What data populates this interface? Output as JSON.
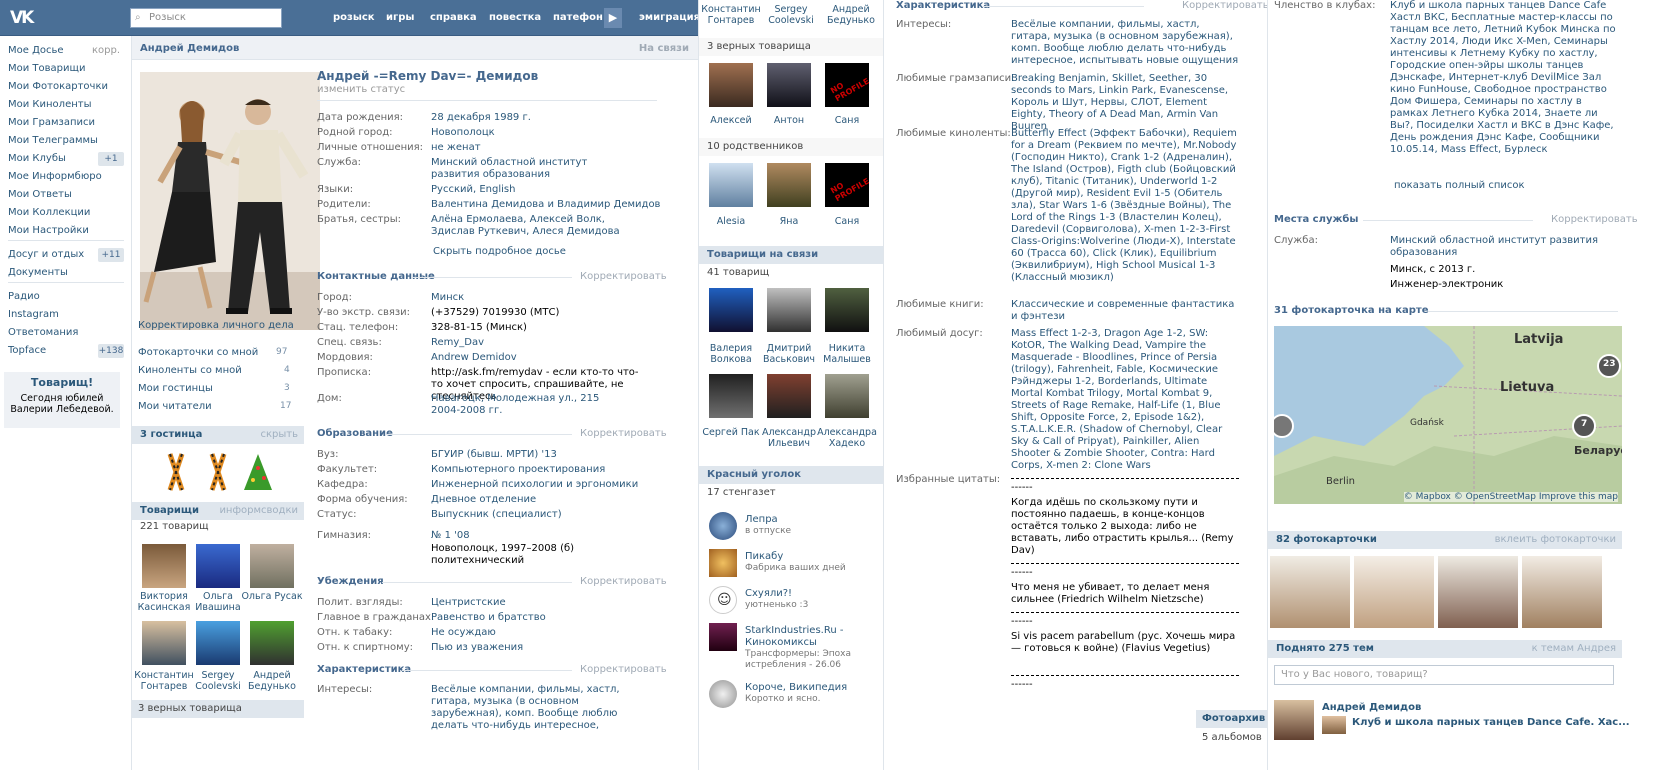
{
  "topbar": {
    "search_placeholder": "Розыск",
    "nav": [
      "розыск",
      "игры",
      "справка",
      "повестка",
      "патефон",
      "эмиграция"
    ]
  },
  "leftmenu": {
    "items": [
      {
        "label": "Мое Досье",
        "extra": "корр."
      },
      {
        "label": "Мои Товарищи"
      },
      {
        "label": "Мои Фотокарточки"
      },
      {
        "label": "Мои Киноленты"
      },
      {
        "label": "Мои Грамзаписи"
      },
      {
        "label": "Мои Телеграммы"
      },
      {
        "label": "Мои Клубы",
        "count": "+1"
      },
      {
        "label": "Мое Информбюро"
      },
      {
        "label": "Мои Ответы"
      },
      {
        "label": "Мои Коллекции"
      },
      {
        "label": "Мои Настройки"
      },
      {
        "label": "Досуг и отдых",
        "count": "+11"
      },
      {
        "label": "Документы"
      },
      {
        "label": "Радио"
      },
      {
        "label": "Instagram"
      },
      {
        "label": "Ответомания"
      },
      {
        "label": "Topface",
        "count": "+138"
      }
    ],
    "birthday": {
      "title": "Товарищ!",
      "text1": "Сегодня юбилей",
      "text2": "Валерии Лебедевой."
    }
  },
  "profile": {
    "header_name": "Андрей Демидов",
    "header_status": "На связи",
    "full_name": "Андрей -=Remy Dav=- Демидов",
    "change_status": "изменить статус",
    "edit_dossier": "Корректировка личного дела",
    "links": [
      {
        "label": "Фотокарточки со мной",
        "count": "97"
      },
      {
        "label": "Киноленты со мной",
        "count": "4"
      },
      {
        "label": "Мои гостинцы",
        "count": "3"
      },
      {
        "label": "Мои читатели",
        "count": "17"
      }
    ],
    "gifts_title": "3 гостинца",
    "gifts_hide": "скрыть",
    "friends_title": "Товарищи",
    "friends_link": "информсводки",
    "friends_count": "221 товарищ",
    "friends": [
      "Виктория Касинская",
      "Ольга Ивашина",
      "Ольга Русак",
      "Константин Гонтарев",
      "Sergey Coolevski",
      "Андрей Бедунько"
    ],
    "loyal_bottom": "3 верных товарища",
    "basic": [
      {
        "k": "Дата рождения:",
        "v": "28 декабря 1989 г."
      },
      {
        "k": "Родной город:",
        "v": "Новополоцк"
      },
      {
        "k": "Личные отношения:",
        "v": "не женат"
      },
      {
        "k": "Служба:",
        "v": "Минский областной институт развития образования"
      },
      {
        "k": "Языки:",
        "v": "Русский, English"
      },
      {
        "k": "Родители:",
        "v": "Валентина Демидова и Владимир Демидов"
      },
      {
        "k": "Братья, сестры:",
        "v": "Алёна Ермолаева, Алексей Волк, Здислав Руткевич, Алеся Демидова"
      }
    ],
    "hide_dossier": "Скрыть подробное досье",
    "contacts_title": "Контактные данные",
    "edit": "Корректировать",
    "contacts": [
      {
        "k": "Город:",
        "v": "Минск"
      },
      {
        "k": "У-во экстр. связи:",
        "v": "(+37529) 7019930 (МТС)"
      },
      {
        "k": "Стац. телефон:",
        "v": "328-81-15 (Минск)"
      },
      {
        "k": "Спец. связь:",
        "v": "Remy_Dav"
      },
      {
        "k": "Мордовия:",
        "v": "Andrew Demidov"
      },
      {
        "k": "Прописка:",
        "v": "http://ask.fm/remydav - если кто-то что-то хочет спросить, спрашивайте, не стесняйтесь"
      },
      {
        "k": "Дом:",
        "v": "Навагоцк, Молодежная ул., 215 2004-2008 гг."
      }
    ],
    "edu_title": "Образование",
    "edu": [
      {
        "k": "Вуз:",
        "v": "БГУИР (бывш. МРТИ) '13"
      },
      {
        "k": "Факультет:",
        "v": "Компьютерного проектирования"
      },
      {
        "k": "Кафедра:",
        "v": "Инженерной психологии и эргономики"
      },
      {
        "k": "Форма обучения:",
        "v": "Дневное отделение"
      },
      {
        "k": "Статус:",
        "v": "Выпускник (специалист)"
      },
      {
        "k": "Гимназия:",
        "v": "№ 1 '08"
      }
    ],
    "gym_extra": "Новополоцк, 1997–2008 (б) политехнический",
    "beliefs_title": "Убеждения",
    "beliefs": [
      {
        "k": "Полит. взгляды:",
        "v": "Центристские"
      },
      {
        "k": "Главное в гражданах:",
        "v": "Равенство и братство"
      },
      {
        "k": "Отн. к табаку:",
        "v": "Не осуждаю"
      },
      {
        "k": "Отн. к спиртному:",
        "v": "Пью из уважения"
      }
    ],
    "char_title": "Характеристика",
    "interests_k": "Интересы:",
    "interests_v": "Весёлые компании, фильмы, хастл, гитара, музыка (в основном зарубежная), комп. Вообще люблю делать что-нибудь интересное, испытывать новые ощущения"
  },
  "col2": {
    "top_names": [
      "Константин Гонтарев",
      "Sergey Coolevski",
      "Андрей Бедунько"
    ],
    "loyal": "3 верных товарища",
    "loyal_names": [
      "Алексей",
      "Антон",
      "Саня"
    ],
    "relatives": "10 родственников",
    "rel_names": [
      "Alesia",
      "Яна",
      "Саня"
    ],
    "online_title": "Товарищи на связи",
    "online_count": "41 товарищ",
    "online_names": [
      "Валерия Волкова",
      "Дмитрий Васькович",
      "Никита Малышев",
      "Сергей Пак",
      "Александр Ильевич",
      "Александра Хадеко"
    ],
    "corner_title": "Красный уголок",
    "corner_count": "17 стенгазет",
    "groups": [
      {
        "name": "Лепра",
        "sub": "в отпуске"
      },
      {
        "name": "Пикабу",
        "sub": "Фабрика ваших дней"
      },
      {
        "name": "Схуяли?!",
        "sub": "уютненько :3"
      },
      {
        "name": "StarkIndustries.Ru - Кинокомиксы",
        "sub": "Трансформеры: Эпоха истребления - 26.06"
      },
      {
        "name": "Короче, Википедия",
        "sub": "Коротко и ясно."
      }
    ]
  },
  "col3": {
    "title": "Характеристика",
    "edit": "Корректировать",
    "rows": [
      {
        "k": "Интересы:",
        "v": "Весёлые компании, фильмы, хастл, гитара, музыка (в основном зарубежная), комп. Вообще люблю делать что-нибудь интересное, испытывать новые ощущения"
      },
      {
        "k": "Любимые грамзаписи:",
        "v": "Breaking Benjamin, Skillet, Seether, 30 seconds to Mars, Linkin Park, Evanescense, Король и Шут, Нервы, СЛОТ, Element Eighty, Theory of A Dead Man, Armin Van Buuren"
      },
      {
        "k": "Любимые киноленты:",
        "v": "Butterfly Effect (Эффект Бабочки), Requiem for a Dream (Реквием по мечте), Mr.Nobody (Господин Никто), Crank 1-2 (Адреналин), The Island (Остров), Figth club (Бойцовский клуб), Titanic (Титаник), Underworld 1-2 (Другой мир), Resident Evil 1-5 (Обитель зла), Star Wars 1-6 (Звёздные Войны), The Lord of the Rings 1-3 (Властелин Колец), Daredevil (Сорвиголова), X-men 1-2-3-First Class-Origins:Wolverine (Люди-X), Interstate 60 (Трасса 60), Click (Клик), Equilibrium (Эквилибриум), High School Musical 1-3 (Классный мюзикл)"
      },
      {
        "k": "Любимые книги:",
        "v": "Классические и современные фантастика и фэнтези"
      },
      {
        "k": "Любимый досуг:",
        "v": "Mass Effect 1-2-3, Dragon Age 1-2, SW: KotOR, The Walking Dead, Vampire the Masquerade - Bloodlines, Prince of Persia (trilogy), Fahrenheit, Fable, Космические Рэйнджеры 1-2, Borderlands, Ultimate Mortal Kombat Trilogy, Mortal Kombat 9, Streets of Rage Remake, Half-Life (1, Blue Shift, Opposite Force, 2, Episode 1&2), S.T.A.L.K.E.R. (Shadow of Chernobyl, Clear Sky & Call of Pripyat), Painkiller, Alien Shooter & Zombie Shooter, Contra: Hard Corps, X-men 2: Clone Wars"
      },
      {
        "k": "Избранные цитаты:",
        "v": ""
      }
    ],
    "quotes": [
      "Когда идёшь по скользкому пути и постоянно падаешь, в конце-концов остаётся только 2 выхода: либо не вставать, либо отрастить крылья... (Remy Dav)",
      "Что меня не убивает, то делает меня сильнее (Friedrich Wilhelm Nietzsche)",
      "Si vis pacem parabellum (рус. Хочешь мира — готовься к войне) (Flavius Vegetius)"
    ],
    "archive": "Фотоархив",
    "archive_count": "5 альбомов"
  },
  "col4": {
    "clubs_k": "Членство в клубах:",
    "clubs_v": "Клуб и школа парных танцев Dance Cafe Хастл ВКС, Бесплатные мастер-классы по танцам все лето, Летний Кубок Минска по Хастлу 2014, Люди Икс X-Men, Семинары интенсивы к Летнему Кубку по хастлу, Городские опен-эйры школы танцев Дэнскафе, Интернет-клуб DevilMice Зал кино FunHouse, Свободное пространство Дом Фишера, Семинары по хастлу в рамках Летнего Кубка 2014, Знаете ли Вы?, Посиделки Хастл и ВКС в Дэнс Кафе, День рождения Дэнс Кафе, Сообщники 10.05.14, Mass Effect, Бурлеск",
    "show_all": "показать полный список",
    "work_title": "Места службы",
    "edit": "Корректировать",
    "work_k": "Служба:",
    "work_v": "Минский областной институт развития образования",
    "work_city": "Минск, с 2013 г.",
    "work_pos": "Инженер-электроник",
    "map_title": "31 фотокарточка на карте",
    "map_labels": [
      "Latvija",
      "Lietuva",
      "Gdańsk",
      "Berlin",
      "Беларусь"
    ],
    "map_badges": [
      "23",
      "7"
    ],
    "map_credit": "© Mapbox © OpenStreetMap Improve this map",
    "photos_title": "82 фотокарточки",
    "photos_link": "вклеить фотокарточки",
    "topics_title": "Поднято 275 тем",
    "topics_link": "к темам Андрея",
    "post_placeholder": "Что у Вас нового, товарищ?",
    "post_author": "Андрей Демидов",
    "post_text": "Клуб и школа парных танцев Dance Cafe. Хас..."
  }
}
